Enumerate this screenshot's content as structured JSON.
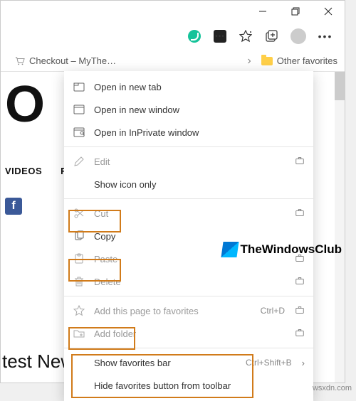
{
  "titlebar": {
    "minimize": "minimize",
    "maximize": "maximize",
    "close": "close"
  },
  "toolbar": {
    "grammarly": "grammarly-extension",
    "extension": "extension-menu",
    "favorites_star": "add-to-favorites",
    "collections": "collections",
    "profile": "profile",
    "more": "settings-and-more"
  },
  "favbar": {
    "crumb": "Checkout – MyThe…",
    "chevron": "›",
    "other_favorites": "Other favorites"
  },
  "page": {
    "big_char": "O",
    "tab_videos": "VIDEOS",
    "tab_f": "F",
    "fb": "f",
    "latest": "test News"
  },
  "ctx": {
    "open_new_tab": "Open in new tab",
    "open_new_window": "Open in new window",
    "open_inprivate": "Open in InPrivate window",
    "edit": "Edit",
    "show_icon_only": "Show icon only",
    "cut": "Cut",
    "copy": "Copy",
    "paste": "Paste",
    "delete": "Delete",
    "add_this_page": "Add this page to favorites",
    "add_this_page_shortcut": "Ctrl+D",
    "add_folder": "Add folder",
    "show_fav_bar": "Show favorites bar",
    "show_fav_bar_shortcut": "Ctrl+Shift+B",
    "hide_fav_button": "Hide favorites button from toolbar"
  },
  "watermark": {
    "text": "TheWindowsClub",
    "footer": "wsxdn.com"
  }
}
